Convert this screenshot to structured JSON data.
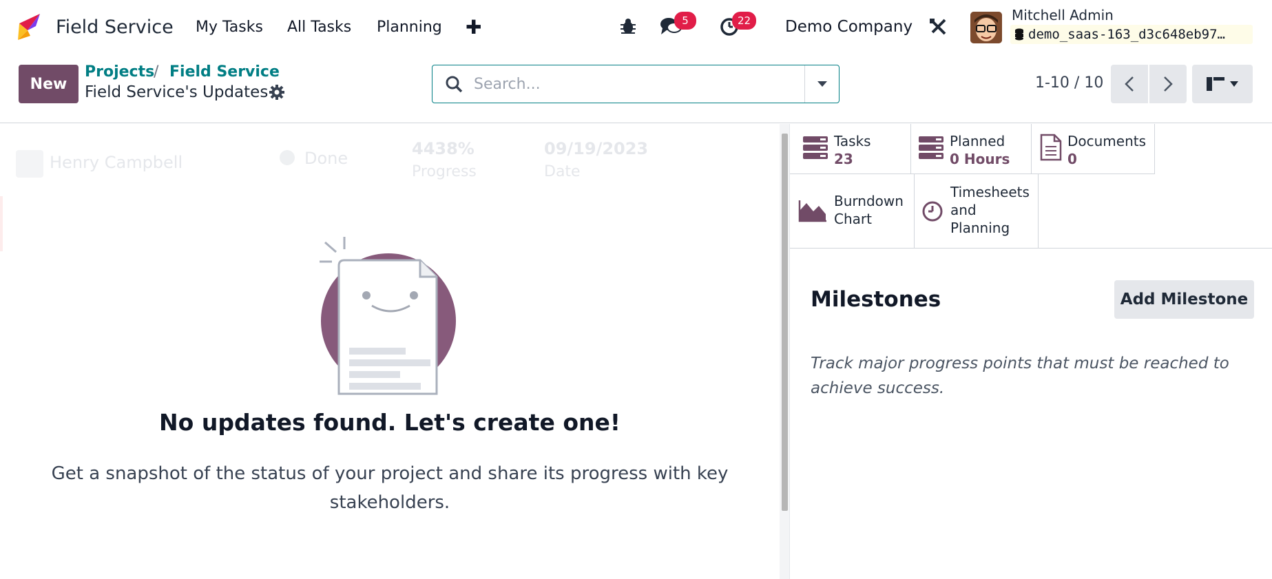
{
  "navbar": {
    "app_title": "Field Service",
    "menu": [
      "My Tasks",
      "All Tasks",
      "Planning"
    ],
    "plus": "✚",
    "messages_count": "5",
    "activities_count": "22",
    "company": "Demo Company",
    "user_name": "Mitchell Admin",
    "database": "demo_saas-163_d3c648eb97…"
  },
  "control_panel": {
    "new_button": "New",
    "breadcrumbs": [
      "Projects",
      "Field Service"
    ],
    "breadcrumb_separator": "/",
    "page_title": "Field Service's Updates",
    "search_placeholder": "Search...",
    "pager": "1-10 / 10"
  },
  "background_row": {
    "name": "Henry Campbell",
    "status": "Done",
    "progress_value": "4438%",
    "progress_label": "Progress",
    "date_value": "09/19/2023",
    "date_label": "Date"
  },
  "empty_state": {
    "title": "No updates found. Let's create one!",
    "text": "Get a snapshot of the status of your project and share its progress with key stakeholders."
  },
  "stats": {
    "tasks": {
      "label": "Tasks",
      "value": "23"
    },
    "planned": {
      "label": "Planned",
      "value": "0 Hours"
    },
    "documents": {
      "label": "Documents",
      "value": "0"
    },
    "burndown": {
      "line1": "Burndown",
      "line2": "Chart"
    },
    "timesheets": {
      "line1": "Timesheets",
      "line2": "and",
      "line3": "Planning"
    }
  },
  "milestones": {
    "title": "Milestones",
    "add_button": "Add Milestone",
    "help": "Track major progress points that must be reached to achieve success."
  },
  "colors": {
    "brand": "#714b67",
    "link": "#017e84",
    "badge": "#e11d48"
  }
}
